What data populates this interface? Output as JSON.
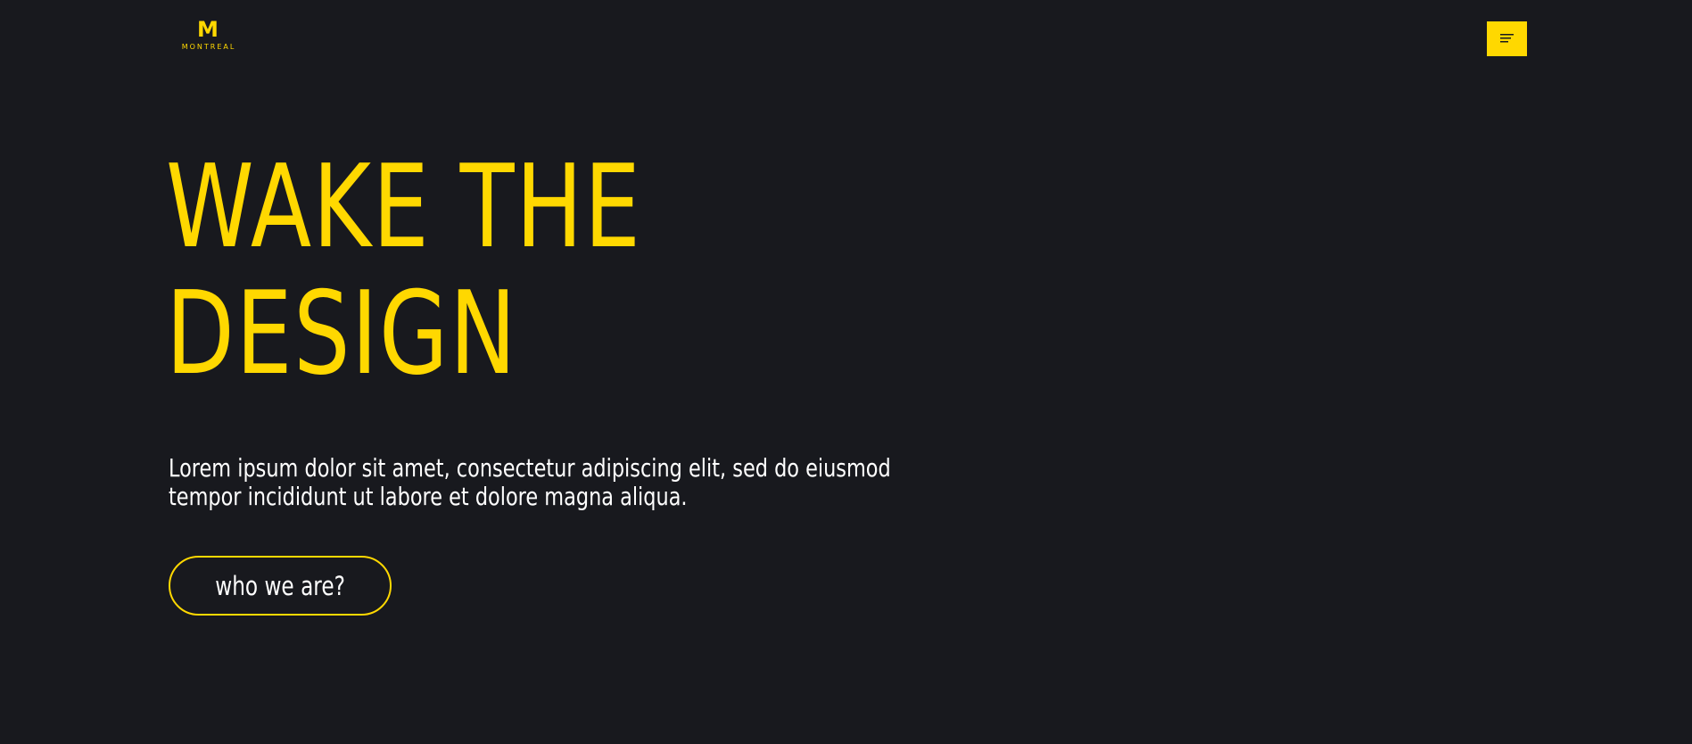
{
  "brand": {
    "logo_letter": "M",
    "logo_word": "MONTREAL",
    "accent_color": "#ffd800",
    "background_color": "#18191e"
  },
  "header": {
    "menu_icon": "menu-icon"
  },
  "hero": {
    "title_line1": "WAKE THE",
    "title_line2": "DESIGN",
    "description_line1": "Lorem ipsum dolor sit amet, consectetur adipiscing elit, sed do eiusmod",
    "description_line2": "tempor incididunt ut labore et dolore magna aliqua.",
    "cta_label": "who we are?"
  }
}
